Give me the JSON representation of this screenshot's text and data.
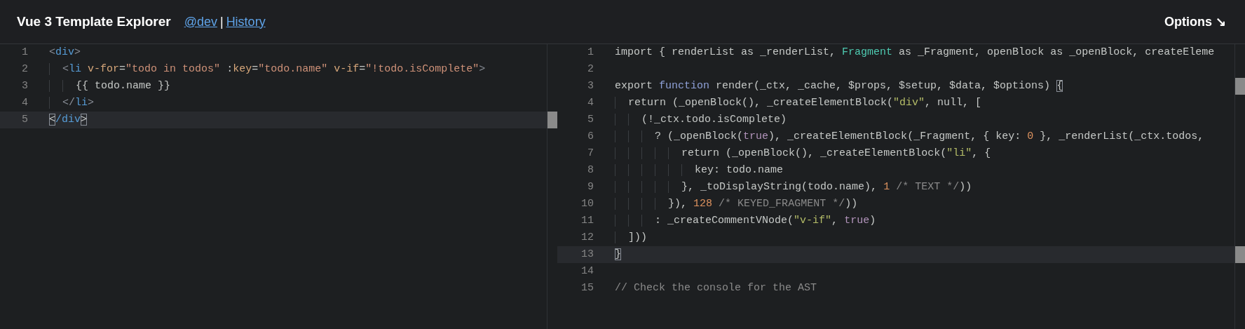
{
  "header": {
    "title": "Vue 3 Template Explorer",
    "links": [
      {
        "label": "@dev"
      },
      {
        "label": "History"
      }
    ],
    "separator": "|",
    "options_button": "Options ↘"
  },
  "template_editor": {
    "lines": [
      {
        "number": "1",
        "active": false,
        "tokens": [
          {
            "kind": "punct",
            "text": "<"
          },
          {
            "kind": "tag",
            "text": "div"
          },
          {
            "kind": "punct",
            "text": ">"
          }
        ]
      },
      {
        "number": "2",
        "active": false,
        "tokens": [
          {
            "kind": "punct",
            "text": "  <"
          },
          {
            "kind": "tag",
            "text": "li"
          },
          {
            "kind": "attr",
            "text": " v-for"
          },
          {
            "kind": "plain",
            "text": "="
          },
          {
            "kind": "string",
            "text": "\"todo in todos\""
          },
          {
            "kind": "plain",
            "text": " :"
          },
          {
            "kind": "attr",
            "text": "key"
          },
          {
            "kind": "plain",
            "text": "="
          },
          {
            "kind": "string",
            "text": "\"todo.name\""
          },
          {
            "kind": "attr",
            "text": " v-if"
          },
          {
            "kind": "plain",
            "text": "="
          },
          {
            "kind": "string",
            "text": "\"!todo.isComplete\""
          },
          {
            "kind": "punct",
            "text": ">"
          }
        ]
      },
      {
        "number": "3",
        "active": false,
        "tokens": [
          {
            "kind": "plain",
            "text": "    {{ todo.name }}"
          }
        ]
      },
      {
        "number": "4",
        "active": false,
        "tokens": [
          {
            "kind": "punct",
            "text": "  </"
          },
          {
            "kind": "tag",
            "text": "li"
          },
          {
            "kind": "punct",
            "text": ">"
          }
        ]
      },
      {
        "number": "5",
        "active": true,
        "tokens": [
          {
            "kind": "match",
            "text": "<"
          },
          {
            "kind": "tag",
            "text": "/div"
          },
          {
            "kind": "match",
            "text": ">"
          }
        ]
      }
    ]
  },
  "output_editor": {
    "lines": [
      {
        "number": "1",
        "active": false,
        "tokens": [
          {
            "kind": "plain",
            "text": "import { renderList as _renderList, "
          },
          {
            "kind": "type",
            "text": "Fragment"
          },
          {
            "kind": "plain",
            "text": " as _Fragment, openBlock as _openBlock, createEleme"
          }
        ]
      },
      {
        "number": "2",
        "active": false
      },
      {
        "number": "3",
        "active": false,
        "tokens": [
          {
            "kind": "plain",
            "text": "export "
          },
          {
            "kind": "keyword",
            "text": "function"
          },
          {
            "kind": "plain",
            "text": " render(_ctx, _cache, $props, $setup, $data, $options) "
          },
          {
            "kind": "match",
            "text": "{"
          }
        ]
      },
      {
        "number": "4",
        "active": false,
        "tokens": [
          {
            "kind": "plain",
            "text": "  return (_openBlock(), _createElementBlock("
          },
          {
            "kind": "string",
            "text": "\"div\""
          },
          {
            "kind": "plain",
            "text": ", null, ["
          }
        ]
      },
      {
        "number": "5",
        "active": false,
        "tokens": [
          {
            "kind": "plain",
            "text": "    (!_ctx.todo.isComplete)"
          }
        ]
      },
      {
        "number": "6",
        "active": false,
        "tokens": [
          {
            "kind": "plain",
            "text": "      ? (_openBlock("
          },
          {
            "kind": "boolean",
            "text": "true"
          },
          {
            "kind": "plain",
            "text": "), _createElementBlock(_Fragment, { key: "
          },
          {
            "kind": "number",
            "text": "0"
          },
          {
            "kind": "plain",
            "text": " }, _renderList(_ctx.todos,"
          }
        ]
      },
      {
        "number": "7",
        "active": false,
        "tokens": [
          {
            "kind": "plain",
            "text": "          return (_openBlock(), _createElementBlock("
          },
          {
            "kind": "string",
            "text": "\"li\""
          },
          {
            "kind": "plain",
            "text": ", {"
          }
        ]
      },
      {
        "number": "8",
        "active": false,
        "tokens": [
          {
            "kind": "plain",
            "text": "            key: todo.name"
          }
        ]
      },
      {
        "number": "9",
        "active": false,
        "tokens": [
          {
            "kind": "plain",
            "text": "          }, _toDisplayString(todo.name), "
          },
          {
            "kind": "number",
            "text": "1"
          },
          {
            "kind": "comment",
            "text": " /* TEXT */"
          },
          {
            "kind": "plain",
            "text": "))"
          }
        ]
      },
      {
        "number": "10",
        "active": false,
        "tokens": [
          {
            "kind": "plain",
            "text": "        }), "
          },
          {
            "kind": "number",
            "text": "128"
          },
          {
            "kind": "comment",
            "text": " /* KEYED_FRAGMENT */"
          },
          {
            "kind": "plain",
            "text": "))"
          }
        ]
      },
      {
        "number": "11",
        "active": false,
        "tokens": [
          {
            "kind": "plain",
            "text": "      : _createCommentVNode("
          },
          {
            "kind": "string",
            "text": "\"v-if\""
          },
          {
            "kind": "plain",
            "text": ", "
          },
          {
            "kind": "boolean",
            "text": "true"
          },
          {
            "kind": "plain",
            "text": ")"
          }
        ]
      },
      {
        "number": "12",
        "active": false,
        "tokens": [
          {
            "kind": "plain",
            "text": "  ]))"
          }
        ]
      },
      {
        "number": "13",
        "active": true,
        "tokens": [
          {
            "kind": "match",
            "text": "}"
          }
        ]
      },
      {
        "number": "14",
        "active": false
      },
      {
        "number": "15",
        "active": false,
        "tokens": [
          {
            "kind": "comment",
            "text": "// Check the console for the AST"
          }
        ]
      }
    ]
  }
}
